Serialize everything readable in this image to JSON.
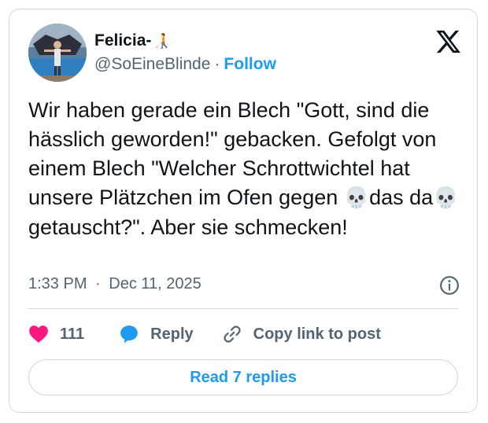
{
  "author": {
    "display_name": "Felicia-",
    "name_emoji": "🧑‍🦯",
    "handle": "@SoEineBlinde",
    "separator": "·",
    "follow_label": "Follow"
  },
  "platform_icon": "x-logo-icon",
  "tweet": {
    "part1": "Wir haben gerade ein Blech \"Gott, sind die hässlich geworden!\" gebacken. Gefolgt von einem Blech \"Welcher Schrottwichtel hat unsere Plätzchen im Ofen gegen ",
    "emoji1": "💀",
    "part2": "das da",
    "emoji2": "💀",
    "part3": "getauscht?\". Aber sie schmecken!"
  },
  "meta": {
    "time": "1:33 PM",
    "separator": "·",
    "date": "Dec 11, 2025"
  },
  "actions": {
    "like_count": "111",
    "reply_label": "Reply",
    "copy_link_label": "Copy link to post"
  },
  "read_replies_label": "Read 7 replies",
  "colors": {
    "accent": "#1d9bf0",
    "like": "#f91880",
    "text": "#0f1419",
    "muted": "#536471",
    "border": "#cfd9de"
  }
}
